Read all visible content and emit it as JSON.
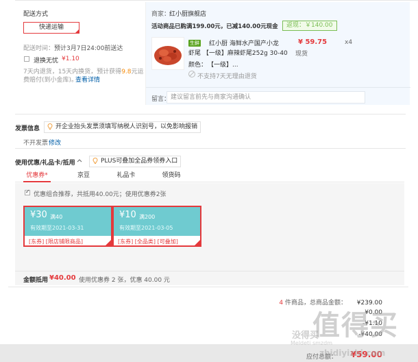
{
  "shipping": {
    "title": "配送方式",
    "method_button": "快递运输",
    "time_label": "配送时间：",
    "time_value": "预计3月7日24:00前送达",
    "return_label": "退换无忧",
    "return_price": "¥1.10",
    "return_desc_1": "7天内退货，15天内换货，预计获得",
    "return_amount": "9.8",
    "return_desc_2": "元运",
    "return_desc_3": "费赔付(到小金库)。",
    "return_link": "查看详情"
  },
  "shop": {
    "shop_label": "商家：",
    "shop_name": "红小厨旗舰店",
    "promo_label": "活动商品已购满199.00元，已减140.00元现金",
    "promo_tag": "返现：￥140.00",
    "product_badge": "生鲜",
    "product_name_1": "红小厨 海鲜水产国产小龙",
    "product_name_2": "虾尾 【一级】麻辣虾尾252g 30-40",
    "color_label": "颜色：",
    "color_value": "【一级】...",
    "price": "¥ 59.75",
    "stock": "现货",
    "quantity": "x4",
    "no_return_note": "不支持7天无理由退货",
    "memo_label": "留言：",
    "memo_placeholder": "建议留言前先与商家沟通确认"
  },
  "invoice": {
    "title": "发票信息",
    "tip": "开企业抬头发票须填写纳税人识别号，以免影响报销",
    "value": "不开发票",
    "edit_link": "修改"
  },
  "discount": {
    "title": "使用优惠/礼品卡/抵用",
    "plus_tip": "PLUS可叠加全品券领券入口",
    "tabs": [
      "优惠券*",
      "京豆",
      "礼品卡",
      "领货码"
    ],
    "combo_text": "优惠组合推荐，共抵用40.00元；使用优惠券2张",
    "coupons": [
      {
        "amount": "¥30",
        "condition": "满40",
        "expiry": "有效期至2021-03-31",
        "tags": "[东券] [限店铺限商品]"
      },
      {
        "amount": "¥10",
        "condition": "满200",
        "expiry": "有效期至2021-03-05",
        "tags": "[东券] [全品类] [可叠加]"
      }
    ],
    "total_label": "金额抵用",
    "total_value": "¥40.00",
    "total_desc": "使用优惠券 2 张，优惠 40.00 元"
  },
  "summary": {
    "count": "4",
    "count_label": " 件商品，总商品金额：",
    "goods_total": "¥239.00",
    "row2": "¥0.00",
    "row3": "-¥1.10",
    "row4": "-¥40.00",
    "payable_label": "应付总额：",
    "payable_value": "¥59.00"
  },
  "watermark": {
    "big": "值得买",
    "left": "没得买",
    "small": "Meldeti smzdm",
    "url": "zhidiyizhi.com"
  },
  "colors": {
    "accent_red": "#e4393c",
    "coupon_teal": "#6fcbd0",
    "link_blue": "#005ea7",
    "green": "#7abd54"
  }
}
